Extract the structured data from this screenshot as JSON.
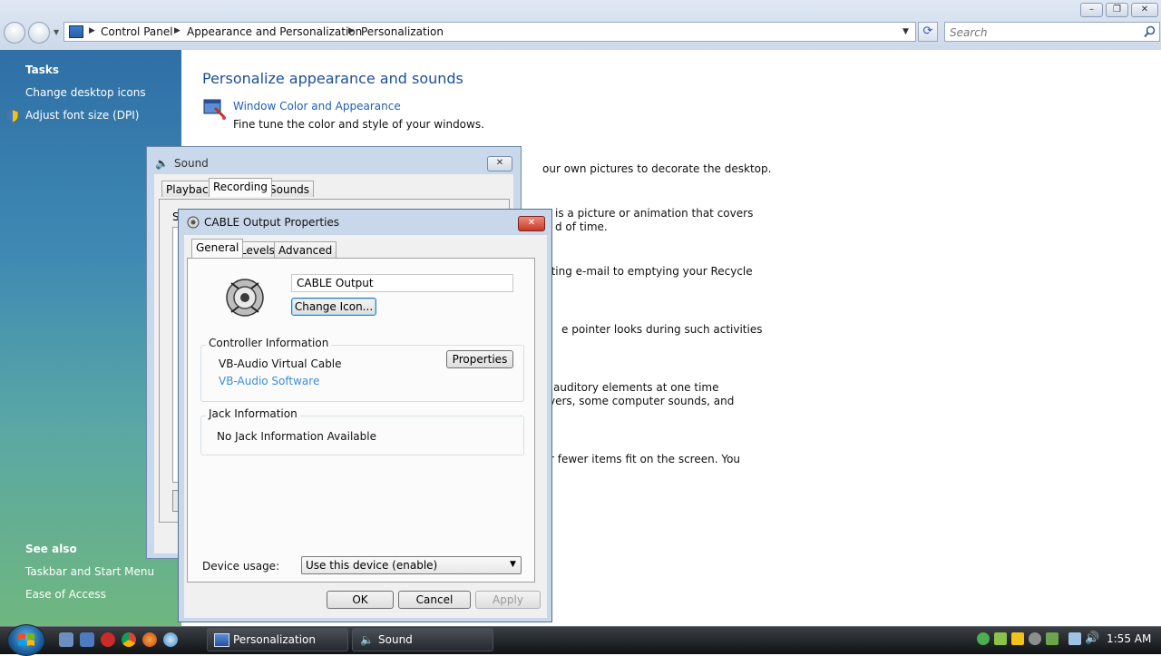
{
  "explorer": {
    "breadcrumb": [
      "Control Panel",
      "Appearance and Personalization",
      "Personalization"
    ],
    "search_placeholder": "Search",
    "sidebar": {
      "tasks_heading": "Tasks",
      "tasks": [
        "Change desktop icons",
        "Adjust font size (DPI)"
      ],
      "see_also_heading": "See also",
      "see_also": [
        "Taskbar and Start Menu",
        "Ease of Access"
      ]
    },
    "main": {
      "heading": "Personalize appearance and sounds",
      "item1_link": "Window Color and Appearance",
      "item1_desc": "Fine tune the color and style of your windows.",
      "fragments": [
        "our own pictures to decorate the desktop.",
        "is a picture or animation that covers",
        "d of time.",
        "cting e-mail to emptying your Recycle",
        "e pointer looks during such activities",
        "auditory elements at one time",
        "vers, some computer sounds, and",
        "r fewer items fit on the screen. You"
      ]
    }
  },
  "sound_dialog": {
    "title": "Sound",
    "tabs": [
      "Playback",
      "Recording",
      "Sounds"
    ],
    "active_tab": "Recording",
    "partial_label": "S"
  },
  "props_dialog": {
    "title": "CABLE Output Properties",
    "tabs": [
      "General",
      "Levels",
      "Advanced"
    ],
    "active_tab": "General",
    "device_name": "CABLE Output",
    "change_icon_label": "Change Icon...",
    "controller": {
      "heading": "Controller Information",
      "name": "VB-Audio Virtual Cable",
      "vendor_link": "VB-Audio Software",
      "properties_label": "Properties"
    },
    "jack": {
      "heading": "Jack Information",
      "text": "No Jack Information Available"
    },
    "device_usage_label": "Device usage:",
    "device_usage_value": "Use this device (enable)",
    "ok_label": "OK",
    "cancel_label": "Cancel",
    "apply_label": "Apply"
  },
  "taskbar": {
    "buttons": [
      "Personalization",
      "Sound"
    ],
    "clock": "1:55 AM"
  },
  "colors": {
    "link": "#1f5fb1",
    "heading_blue": "#1a4f98",
    "sidebar_top": "#2f6fa6",
    "sidebar_bottom": "#6fb77f"
  }
}
